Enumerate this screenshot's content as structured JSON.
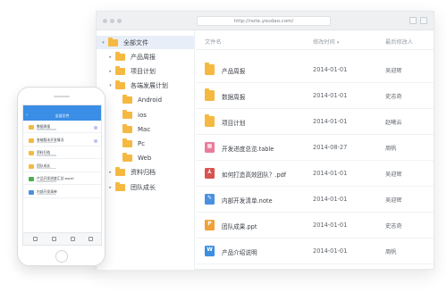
{
  "browser": {
    "url": "http://note.youdao.com/"
  },
  "sidebar": {
    "items": [
      {
        "label": "全部文件",
        "level": 0,
        "caret": "▾",
        "active": true
      },
      {
        "label": "产品周报",
        "level": 1,
        "caret": "▸"
      },
      {
        "label": "项目计划",
        "level": 1,
        "caret": "▸"
      },
      {
        "label": "各端发展计划",
        "level": 1,
        "caret": "▾"
      },
      {
        "label": "Android",
        "level": 2,
        "caret": ""
      },
      {
        "label": "ios",
        "level": 2,
        "caret": ""
      },
      {
        "label": "Mac",
        "level": 2,
        "caret": ""
      },
      {
        "label": "Pc",
        "level": 2,
        "caret": ""
      },
      {
        "label": "Web",
        "level": 2,
        "caret": ""
      },
      {
        "label": "资料归档",
        "level": 1,
        "caret": "▸"
      },
      {
        "label": "团队成长",
        "level": 1,
        "caret": "▸"
      }
    ]
  },
  "list": {
    "columns": {
      "name": "文件名",
      "modified": "修改时间",
      "sort_icon": "▾",
      "modifier": "最后修改人"
    },
    "rows": [
      {
        "name": "产品周报",
        "date": "2014-01-01",
        "user": "吴迎辉",
        "icon": "folder-icon",
        "glyph": ""
      },
      {
        "name": "数据周报",
        "date": "2014-01-01",
        "user": "史志奇",
        "icon": "folder-icon",
        "glyph": ""
      },
      {
        "name": "项目计划",
        "date": "2014-01-01",
        "user": "赵曦云",
        "icon": "folder-icon",
        "glyph": ""
      },
      {
        "name": "开发进度总览.table",
        "date": "2014-08-27",
        "user": "周帆",
        "icon": "table-icon",
        "glyph": "▦"
      },
      {
        "name": "如何打造高效团队？.pdf",
        "date": "2014-01-01",
        "user": "吴迎辉",
        "icon": "pdf-icon",
        "glyph": "⅄"
      },
      {
        "name": "内部开发清单.note",
        "date": "2014-01-01",
        "user": "吴迎辉",
        "icon": "note-icon",
        "glyph": "✎"
      },
      {
        "name": "团队成果.ppt",
        "date": "2014-01-01",
        "user": "史志奇",
        "icon": "ppt-icon",
        "glyph": "P"
      },
      {
        "name": "产品介绍说明",
        "date": "2014-01-01",
        "user": "周帆",
        "icon": "word-icon",
        "glyph": "W"
      }
    ]
  },
  "phone": {
    "title": "全部文件",
    "back": "‹",
    "rows": [
      {
        "name": "数据周报",
        "color": "#f5b942"
      },
      {
        "name": "各端版本开发情况",
        "color": "#f5b942"
      },
      {
        "name": "资料归档",
        "color": "#f5b942"
      },
      {
        "name": "团队成长",
        "color": "#f5b942"
      },
      {
        "name": "产品开发进度汇总.excel",
        "color": "#4caf50"
      },
      {
        "name": "内部开发清单",
        "color": "#4a90e2"
      }
    ]
  }
}
